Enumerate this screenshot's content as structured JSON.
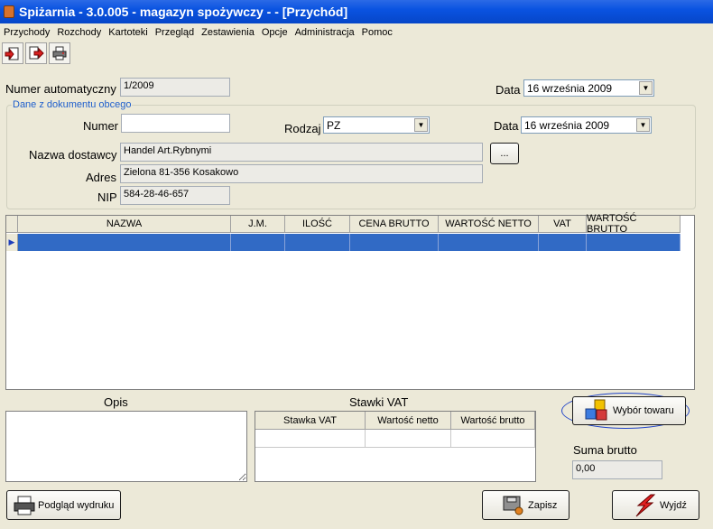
{
  "window": {
    "title": "Spiżarnia - 3.0.005 - magazyn spożywczy -  - [Przychód]"
  },
  "menu": [
    "Przychody",
    "Rozchody",
    "Kartoteki",
    "Przegląd",
    "Zestawienia",
    "Opcje",
    "Administracja",
    "Pomoc"
  ],
  "toolbar": {
    "icons": [
      "new-document-icon",
      "export-icon",
      "print-icon"
    ]
  },
  "form": {
    "numer_auto_label": "Numer automatyczny",
    "numer_auto_value": "1/2009",
    "data1_label": "Data",
    "data1_value": "16   września   2009",
    "group_title": "Dane z dokumentu obcego",
    "numer_label": "Numer",
    "numer_value": "",
    "rodzaj_label": "Rodzaj",
    "rodzaj_value": "PZ",
    "data2_label": "Data",
    "data2_value": "16   września   2009",
    "dostawca_label": "Nazwa dostawcy",
    "dostawca_value": "Handel Art.Rybnymi",
    "ellipsis_label": "...",
    "adres_label": "Adres",
    "adres_value": "Zielona 81-356 Kosakowo",
    "nip_label": "NIP",
    "nip_value": "584-28-46-657"
  },
  "grid": {
    "columns": [
      "NAZWA",
      "J.M.",
      "ILOŚĆ",
      "CENA BRUTTO",
      "WARTOŚĆ NETTO",
      "VAT",
      "WARTOŚĆ BRUTTO"
    ]
  },
  "bottom": {
    "opis_label": "Opis",
    "vat_title": "Stawki VAT",
    "vat_columns": [
      "Stawka VAT",
      "Wartość netto",
      "Wartość brutto"
    ],
    "wybor_label": "Wybór towaru",
    "suma_label": "Suma brutto",
    "suma_value": "0,00"
  },
  "buttons": {
    "podglad": "Podgląd wydruku",
    "zapisz": "Zapisz",
    "wyjdz": "Wyjdź"
  },
  "colors": {
    "titlebar": "#0a53e1",
    "selection": "#316ac5",
    "highlight_ellipse": "#2043c8"
  }
}
